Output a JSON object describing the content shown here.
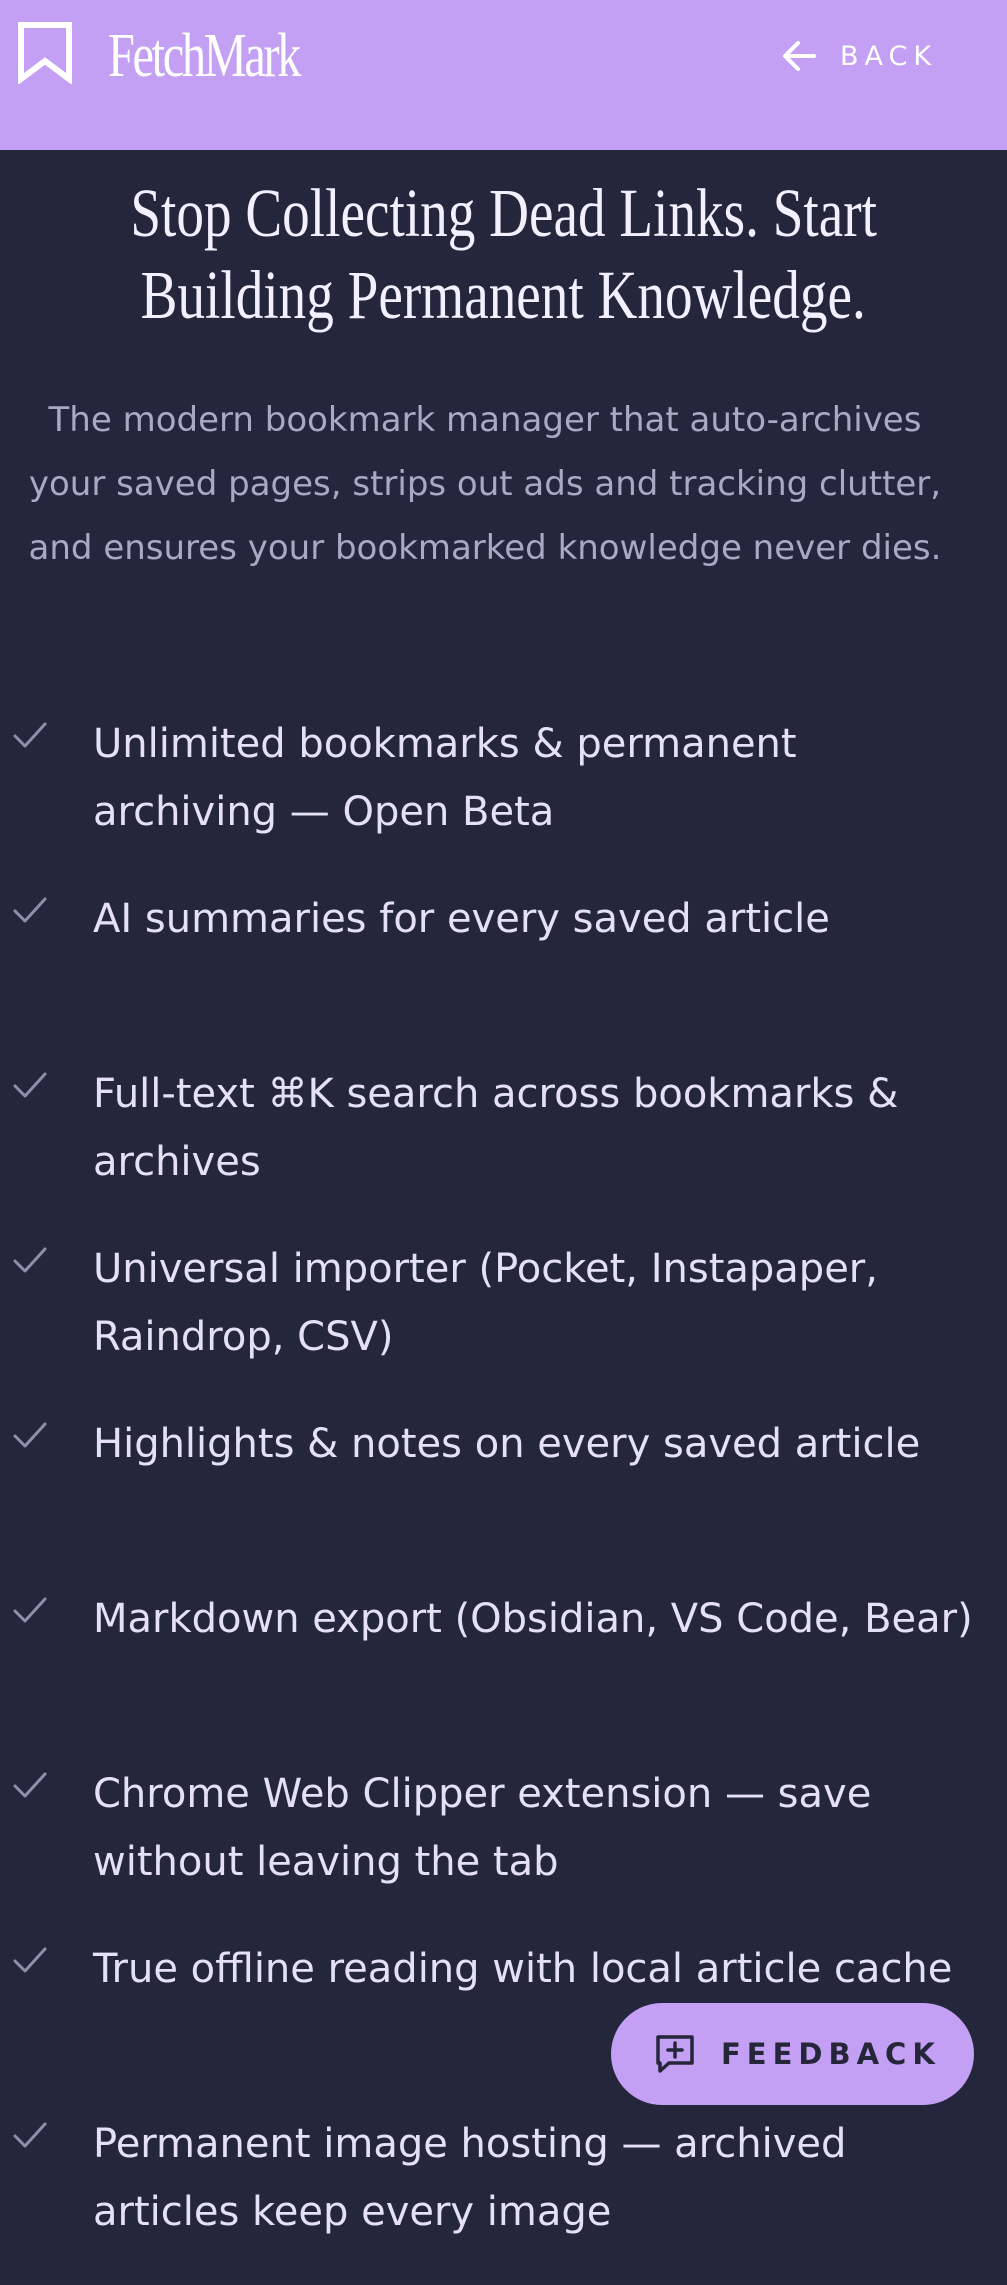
{
  "header": {
    "brand": "FetchMark",
    "back_label": "BACK"
  },
  "hero": {
    "title_line1": "Stop Collecting Dead Links. Start",
    "title_line2": "Building Permanent Knowledge.",
    "subtitle": "The modern bookmark manager that auto-archives your saved pages, strips out ads and tracking clutter, and ensures your bookmarked knowledge never dies."
  },
  "features": [
    {
      "text": "Unlimited bookmarks & permanent archiving — Open Beta"
    },
    {
      "text": "AI summaries for every saved article"
    },
    {
      "text": "Full-text ⌘K search across bookmarks & archives"
    },
    {
      "text": "Universal importer (Pocket, Instapaper, Raindrop, CSV)"
    },
    {
      "text": "Highlights & notes on every saved article"
    },
    {
      "text": "Markdown export (Obsidian, VS Code, Bear)"
    },
    {
      "text": "Chrome Web Clipper extension — save without leaving the tab"
    },
    {
      "text": "True offline reading with local article cache"
    },
    {
      "text": "Permanent image hosting — archived articles keep every image"
    }
  ],
  "feedback": {
    "label": "FEEDBACK"
  },
  "colors": {
    "header_bg": "#c4a0f4",
    "page_bg": "#24263b",
    "accent": "#c4a0f4"
  },
  "icons": {
    "logo": "bookmark-icon",
    "back": "arrow-left-icon",
    "check": "check-icon",
    "feedback": "message-plus-icon"
  }
}
